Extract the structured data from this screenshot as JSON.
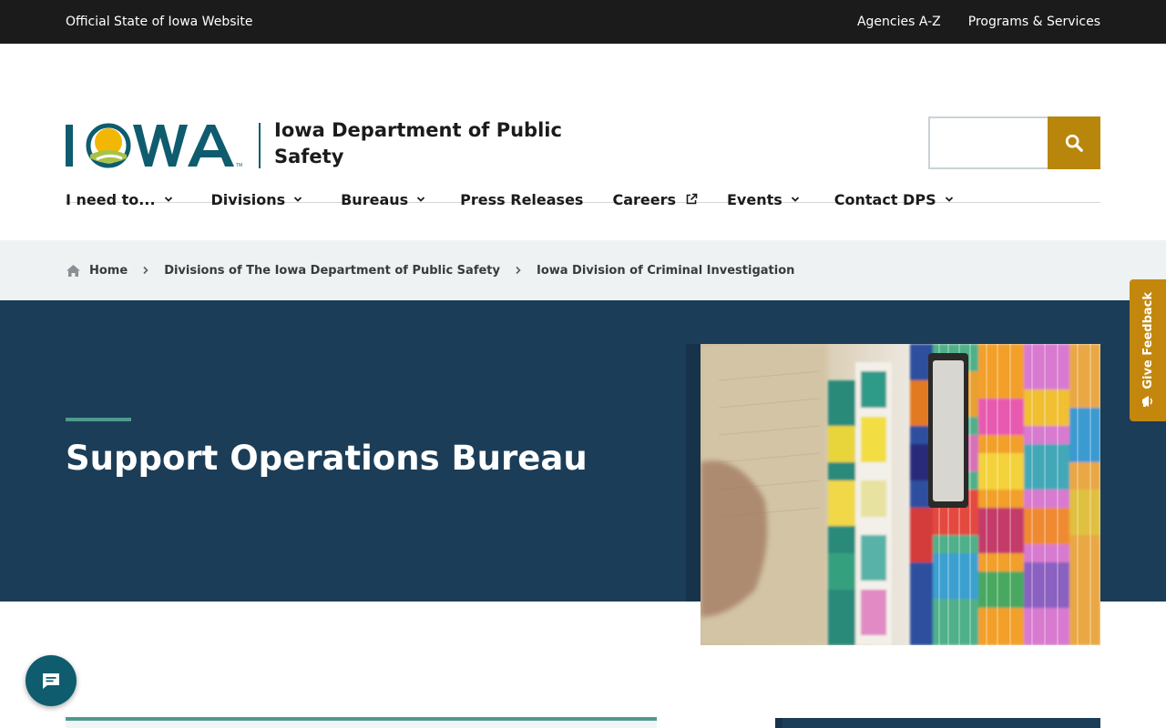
{
  "utility_bar": {
    "official_text": "Official State of Iowa Website",
    "links": [
      "Agencies A-Z",
      "Programs & Services"
    ]
  },
  "header": {
    "logo_text": "IOWA",
    "department_name": "Iowa Department of Public Safety",
    "search": {
      "placeholder": "",
      "button_icon": "search-icon"
    }
  },
  "nav": {
    "items": [
      {
        "label": "I need to...",
        "icon": "chevron-down-icon"
      },
      {
        "label": "Divisions",
        "icon": "chevron-down-icon"
      },
      {
        "label": "Bureaus",
        "icon": "chevron-down-icon"
      },
      {
        "label": "Press Releases",
        "icon": ""
      },
      {
        "label": "Careers",
        "icon": "external-link-icon"
      },
      {
        "label": "Events",
        "icon": "chevron-down-icon"
      },
      {
        "label": "Contact DPS",
        "icon": "chevron-down-icon"
      }
    ]
  },
  "breadcrumb": {
    "items": [
      "Home",
      "Divisions of The Iowa Department of Public Safety",
      "Iowa Division of Criminal Investigation"
    ]
  },
  "hero": {
    "title": "Support Operations Bureau",
    "image_alt": "Color-coded file folders"
  },
  "feedback": {
    "label": "Give Feedback",
    "icon": "megaphone-icon"
  },
  "chat": {
    "icon": "chat-icon"
  },
  "colors": {
    "utility_bg": "#1b1b1b",
    "brand_teal": "#0e5c6e",
    "search_gold": "#b8860b",
    "breadcrumb_bg": "#eef2f3",
    "hero_navy": "#1b3d58",
    "accent_green": "#4f9a8e",
    "feedback_gold": "#c4870e"
  }
}
